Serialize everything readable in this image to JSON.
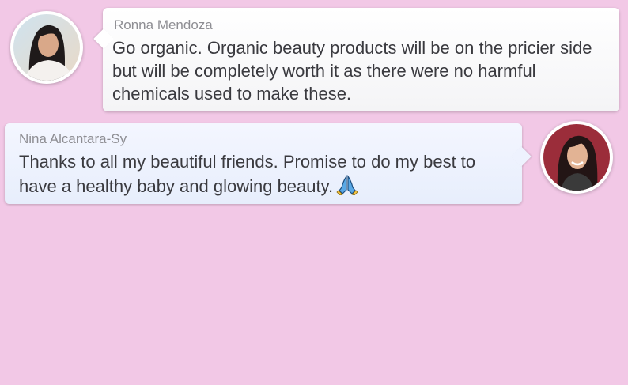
{
  "messages": [
    {
      "author": "Ronna Mendoza",
      "text": "Go organic. Organic beauty products will be on the pricier side but will be completely worth it as there were no harmful chemicals used to make these.",
      "avatar_icon": "avatar-photo-ronna"
    },
    {
      "author": "Nina Alcantara-Sy",
      "text": "Thanks to all my beautiful friends. Promise to do my best to have a healthy baby and glowing beauty.",
      "emoji_icon": "folded-hands-icon",
      "avatar_icon": "avatar-photo-nina"
    }
  ],
  "colors": {
    "background": "#f2c8e6",
    "bubble_left": "#f6f6f8",
    "bubble_right": "#eaf0fd",
    "author_name": "#8e8e93",
    "message_text": "#3a3a3f"
  }
}
